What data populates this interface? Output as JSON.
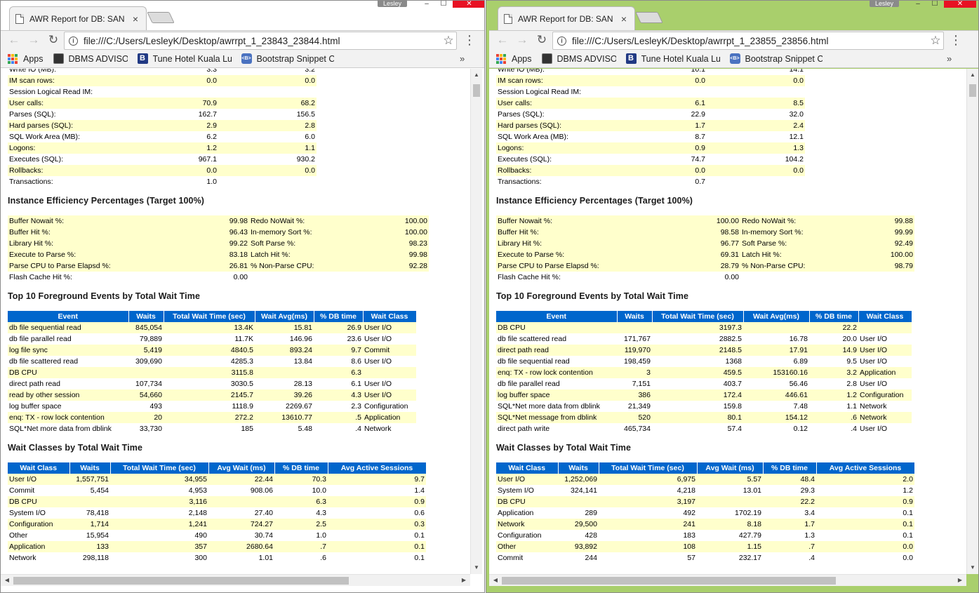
{
  "windows": [
    {
      "tab_title": "AWR Report for DB: SAN",
      "tab_close": "×",
      "user": "Lesley",
      "url": "file:///C:/Users/LesleyK/Desktop/awrrpt_1_23843_23844.html",
      "bookmarks": {
        "apps": "Apps",
        "dbms": "DBMS ADVISOR: Seg",
        "tune": "Tune Hotel Kuala Lun",
        "bootstrap": "Bootstrap Snippet Co",
        "more": "»"
      },
      "load_profile": [
        [
          "Write IO (MB):",
          "3.3",
          "3.2"
        ],
        [
          "IM scan rows:",
          "0.0",
          "0.0"
        ],
        [
          "Session Logical Read IM:",
          "",
          ""
        ],
        [
          "User calls:",
          "70.9",
          "68.2"
        ],
        [
          "Parses (SQL):",
          "162.7",
          "156.5"
        ],
        [
          "Hard parses (SQL):",
          "2.9",
          "2.8"
        ],
        [
          "SQL Work Area (MB):",
          "6.2",
          "6.0"
        ],
        [
          "Logons:",
          "1.2",
          "1.1"
        ],
        [
          "Executes (SQL):",
          "967.1",
          "930.2"
        ],
        [
          "Rollbacks:",
          "0.0",
          "0.0"
        ],
        [
          "Transactions:",
          "1.0",
          ""
        ]
      ],
      "efficiency": {
        "title": "Instance Efficiency Percentages (Target 100%)",
        "rows": [
          [
            "Buffer Nowait %:",
            "99.98",
            "Redo NoWait %:",
            "100.00"
          ],
          [
            "Buffer Hit %:",
            "96.43",
            "In-memory Sort %:",
            "100.00"
          ],
          [
            "Library Hit %:",
            "99.22",
            "Soft Parse %:",
            "98.23"
          ],
          [
            "Execute to Parse %:",
            "83.18",
            "Latch Hit %:",
            "99.98"
          ],
          [
            "Parse CPU to Parse Elapsd %:",
            "26.81",
            "% Non-Parse CPU:",
            "92.28"
          ],
          [
            "Flash Cache Hit %:",
            "0.00",
            "",
            ""
          ]
        ]
      },
      "events": {
        "title": "Top 10 Foreground Events by Total Wait Time",
        "headers": [
          "Event",
          "Waits",
          "Total Wait Time (sec)",
          "Wait Avg(ms)",
          "% DB time",
          "Wait Class"
        ],
        "rows": [
          [
            "db file sequential read",
            "845,054",
            "13.4K",
            "15.81",
            "26.9",
            "User I/O"
          ],
          [
            "db file parallel read",
            "79,889",
            "11.7K",
            "146.96",
            "23.6",
            "User I/O"
          ],
          [
            "log file sync",
            "5,419",
            "4840.5",
            "893.24",
            "9.7",
            "Commit"
          ],
          [
            "db file scattered read",
            "309,690",
            "4285.3",
            "13.84",
            "8.6",
            "User I/O"
          ],
          [
            "DB CPU",
            "",
            "3115.8",
            "",
            "6.3",
            ""
          ],
          [
            "direct path read",
            "107,734",
            "3030.5",
            "28.13",
            "6.1",
            "User I/O"
          ],
          [
            "read by other session",
            "54,660",
            "2145.7",
            "39.26",
            "4.3",
            "User I/O"
          ],
          [
            "log buffer space",
            "493",
            "1118.9",
            "2269.67",
            "2.3",
            "Configuration"
          ],
          [
            "enq: TX - row lock contention",
            "20",
            "272.2",
            "13610.77",
            ".5",
            "Application"
          ],
          [
            "SQL*Net more data from dblink",
            "33,730",
            "185",
            "5.48",
            ".4",
            "Network"
          ]
        ]
      },
      "classes": {
        "title": "Wait Classes by Total Wait Time",
        "headers": [
          "Wait Class",
          "Waits",
          "Total Wait Time (sec)",
          "Avg Wait (ms)",
          "% DB time",
          "Avg Active Sessions"
        ],
        "rows": [
          [
            "User I/O",
            "1,557,751",
            "34,955",
            "22.44",
            "70.3",
            "9.7"
          ],
          [
            "Commit",
            "5,454",
            "4,953",
            "908.06",
            "10.0",
            "1.4"
          ],
          [
            "DB CPU",
            "",
            "3,116",
            "",
            "6.3",
            "0.9"
          ],
          [
            "System I/O",
            "78,418",
            "2,148",
            "27.40",
            "4.3",
            "0.6"
          ],
          [
            "Configuration",
            "1,714",
            "1,241",
            "724.27",
            "2.5",
            "0.3"
          ],
          [
            "Other",
            "15,954",
            "490",
            "30.74",
            "1.0",
            "0.1"
          ],
          [
            "Application",
            "133",
            "357",
            "2680.64",
            ".7",
            "0.1"
          ],
          [
            "Network",
            "298,118",
            "300",
            "1.01",
            ".6",
            "0.1"
          ]
        ]
      }
    },
    {
      "tab_title": "AWR Report for DB: SAN",
      "tab_close": "×",
      "user": "Lesley",
      "url": "file:///C:/Users/LesleyK/Desktop/awrrpt_1_23855_23856.html",
      "bookmarks": {
        "apps": "Apps",
        "dbms": "DBMS ADVISOR: Seg",
        "tune": "Tune Hotel Kuala Lun",
        "bootstrap": "Bootstrap Snippet Co",
        "more": "»"
      },
      "load_profile": [
        [
          "Write IO (MB):",
          "10.1",
          "14.1"
        ],
        [
          "IM scan rows:",
          "0.0",
          "0.0"
        ],
        [
          "Session Logical Read IM:",
          "",
          ""
        ],
        [
          "User calls:",
          "6.1",
          "8.5"
        ],
        [
          "Parses (SQL):",
          "22.9",
          "32.0"
        ],
        [
          "Hard parses (SQL):",
          "1.7",
          "2.4"
        ],
        [
          "SQL Work Area (MB):",
          "8.7",
          "12.1"
        ],
        [
          "Logons:",
          "0.9",
          "1.3"
        ],
        [
          "Executes (SQL):",
          "74.7",
          "104.2"
        ],
        [
          "Rollbacks:",
          "0.0",
          "0.0"
        ],
        [
          "Transactions:",
          "0.7",
          ""
        ]
      ],
      "efficiency": {
        "title": "Instance Efficiency Percentages (Target 100%)",
        "rows": [
          [
            "Buffer Nowait %:",
            "100.00",
            "Redo NoWait %:",
            "99.88"
          ],
          [
            "Buffer Hit %:",
            "98.58",
            "In-memory Sort %:",
            "99.99"
          ],
          [
            "Library Hit %:",
            "96.77",
            "Soft Parse %:",
            "92.49"
          ],
          [
            "Execute to Parse %:",
            "69.31",
            "Latch Hit %:",
            "100.00"
          ],
          [
            "Parse CPU to Parse Elapsd %:",
            "28.79",
            "% Non-Parse CPU:",
            "98.79"
          ],
          [
            "Flash Cache Hit %:",
            "0.00",
            "",
            ""
          ]
        ]
      },
      "events": {
        "title": "Top 10 Foreground Events by Total Wait Time",
        "headers": [
          "Event",
          "Waits",
          "Total Wait Time (sec)",
          "Wait Avg(ms)",
          "% DB time",
          "Wait Class"
        ],
        "rows": [
          [
            "DB CPU",
            "",
            "3197.3",
            "",
            "22.2",
            ""
          ],
          [
            "db file scattered read",
            "171,767",
            "2882.5",
            "16.78",
            "20.0",
            "User I/O"
          ],
          [
            "direct path read",
            "119,970",
            "2148.5",
            "17.91",
            "14.9",
            "User I/O"
          ],
          [
            "db file sequential read",
            "198,459",
            "1368",
            "6.89",
            "9.5",
            "User I/O"
          ],
          [
            "enq: TX - row lock contention",
            "3",
            "459.5",
            "153160.16",
            "3.2",
            "Application"
          ],
          [
            "db file parallel read",
            "7,151",
            "403.7",
            "56.46",
            "2.8",
            "User I/O"
          ],
          [
            "log buffer space",
            "386",
            "172.4",
            "446.61",
            "1.2",
            "Configuration"
          ],
          [
            "SQL*Net more data from dblink",
            "21,349",
            "159.8",
            "7.48",
            "1.1",
            "Network"
          ],
          [
            "SQL*Net message from dblink",
            "520",
            "80.1",
            "154.12",
            ".6",
            "Network"
          ],
          [
            "direct path write",
            "465,734",
            "57.4",
            "0.12",
            ".4",
            "User I/O"
          ]
        ]
      },
      "classes": {
        "title": "Wait Classes by Total Wait Time",
        "headers": [
          "Wait Class",
          "Waits",
          "Total Wait Time (sec)",
          "Avg Wait (ms)",
          "% DB time",
          "Avg Active Sessions"
        ],
        "rows": [
          [
            "User I/O",
            "1,252,069",
            "6,975",
            "5.57",
            "48.4",
            "2.0"
          ],
          [
            "System I/O",
            "324,141",
            "4,218",
            "13.01",
            "29.3",
            "1.2"
          ],
          [
            "DB CPU",
            "",
            "3,197",
            "",
            "22.2",
            "0.9"
          ],
          [
            "Application",
            "289",
            "492",
            "1702.19",
            "3.4",
            "0.1"
          ],
          [
            "Network",
            "29,500",
            "241",
            "8.18",
            "1.7",
            "0.1"
          ],
          [
            "Configuration",
            "428",
            "183",
            "427.79",
            "1.3",
            "0.1"
          ],
          [
            "Other",
            "93,892",
            "108",
            "1.15",
            ".7",
            "0.0"
          ],
          [
            "Commit",
            "244",
            "57",
            "232.17",
            ".4",
            "0.0"
          ]
        ]
      }
    }
  ],
  "colors": {
    "header_blue": "#0066cc",
    "row_yellow": "#ffffcc",
    "active_window_frame": "#a9cf6c",
    "close_button": "#e81123"
  }
}
